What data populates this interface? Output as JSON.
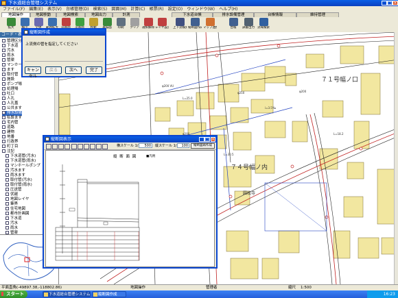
{
  "window": {
    "title": "下水道総合管理システム"
  },
  "menu": [
    "ファイル(F)",
    "編集(E)",
    "表示(V)",
    "台帳管理(D)",
    "検索(S)",
    "図面(M)",
    "計算(C)",
    "帳票(R)",
    "設定(O)",
    "ウィンドウ(W)",
    "ヘルプ(H)"
  ],
  "tabs": [
    {
      "label": "地図操作",
      "active": true
    },
    {
      "label": "地図移動"
    },
    {
      "label": "地図検索"
    },
    {
      "label": "地図出力"
    },
    {
      "label": "計測"
    },
    {
      "label": "下水道台帳"
    },
    {
      "label": "排水設備管理"
    },
    {
      "label": "台帳情報"
    },
    {
      "label": "維持管理"
    }
  ],
  "toolbar_buttons": [
    {
      "label": "拡大",
      "icon": "zoom-in-icon",
      "color": "#3a8a3a"
    },
    {
      "label": "縮小",
      "icon": "zoom-out-icon",
      "color": "#3a6fb0"
    },
    {
      "label": "全体",
      "icon": "zoom-all-icon",
      "color": "#6a6ab0"
    },
    {
      "label": "範囲拡大",
      "icon": "zoom-area-icon",
      "color": "#3a6fb0"
    },
    {
      "label": "前画面",
      "icon": "back-icon",
      "color": "#c04040"
    },
    {
      "label": "次画面",
      "icon": "forward-icon",
      "color": "#40a040"
    },
    {
      "label": "移動",
      "icon": "pan-icon",
      "color": "#c0a030"
    },
    {
      "label": "再描画",
      "icon": "refresh-icon",
      "color": "#3a8a3a"
    },
    {
      "label": "印刷",
      "icon": "print-icon",
      "color": "#607080"
    },
    {
      "label": "クリア",
      "icon": "clear-icon",
      "color": "#a0a0a0"
    },
    {
      "label": "選択解除",
      "icon": "deselect-icon",
      "color": "#c04040"
    },
    {
      "label": "レイヤ設定",
      "icon": "layer-icon",
      "color": "#c04040"
    },
    {
      "label": "上下流検索",
      "icon": "updown-search-icon",
      "color": "#405080"
    },
    {
      "label": "縦断図作成",
      "icon": "profile-icon",
      "color": "#406090"
    },
    {
      "label": "マップ連携",
      "icon": "map-link-icon",
      "color": "#d07030"
    },
    {
      "label": "台帳",
      "icon": "ledger-icon",
      "color": "#406090"
    },
    {
      "label": "調書出力",
      "icon": "report-icon",
      "color": "#506070"
    },
    {
      "label": "流域検索",
      "icon": "basin-icon",
      "color": "#3060a0"
    }
  ],
  "left_panel": {
    "header": "コード・表示",
    "items": [
      "管理区分",
      "下水道",
      "汚水",
      "雨水",
      "管渠",
      "マンホール",
      "ます",
      "取付管",
      "施設",
      "ポンプ場",
      "処理場",
      "吐口",
      "人孔",
      "人孔蓋",
      "公共ます",
      "排水設備",
      "私設ます",
      "宅内管",
      "道路",
      "建物",
      "地番",
      "行政界",
      "町丁目",
      "注記",
      "下水道管(汚水)",
      "下水道管(雨水)",
      "マンホールポンプ",
      "汚水ます",
      "雨水ます",
      "取付管(汚水)",
      "取付管(雨水)",
      "圧送管",
      "伏越",
      "地図レイヤ",
      "筆界",
      "住宅地図",
      "都市計画図",
      "下水道",
      "汚水",
      "雨水",
      "管渠",
      "人孔",
      "ます",
      "取付管",
      "マンホールポンプ",
      "処理場",
      "ポンプ場",
      "吐口",
      "流域",
      "処理区",
      "排水区",
      "計画",
      "工事",
      "管更生",
      "調査",
      "点検",
      "清掃"
    ],
    "highlighted_index": 15
  },
  "map_labels": [
    {
      "text": "７１号幅ノ口"
    },
    {
      "text": "７４号幅ノ内"
    },
    {
      "text": "圓松寺"
    }
  ],
  "dialog_progress": {
    "title": "縦断図作成",
    "message": "上流側の管を指定してください",
    "buttons": [
      "キャンセル",
      "戻る",
      "次へ",
      "完了"
    ]
  },
  "dialog_profile": {
    "title": "縦断図表示",
    "toolbar_scale_x_label": "横スケール 1/",
    "toolbar_scale_x_value": "500",
    "toolbar_scale_y_label": "縦スケール 1/",
    "toolbar_scale_y_value": "100",
    "toolbar_button": "縦断図再作成",
    "drawing_title": "縦 断 面 図",
    "drawing_legend": "■凡例"
  },
  "status": {
    "coords": "平面直角(-49897.38,-118802.86)",
    "scale_label": "縮尺",
    "scale": "1:500",
    "mode": "地図操作",
    "user": "管理者"
  },
  "taskbar": {
    "start": "スタート",
    "tasks": [
      "下水道総合管理システム",
      "縦断図作成"
    ],
    "clock": "16:23"
  }
}
